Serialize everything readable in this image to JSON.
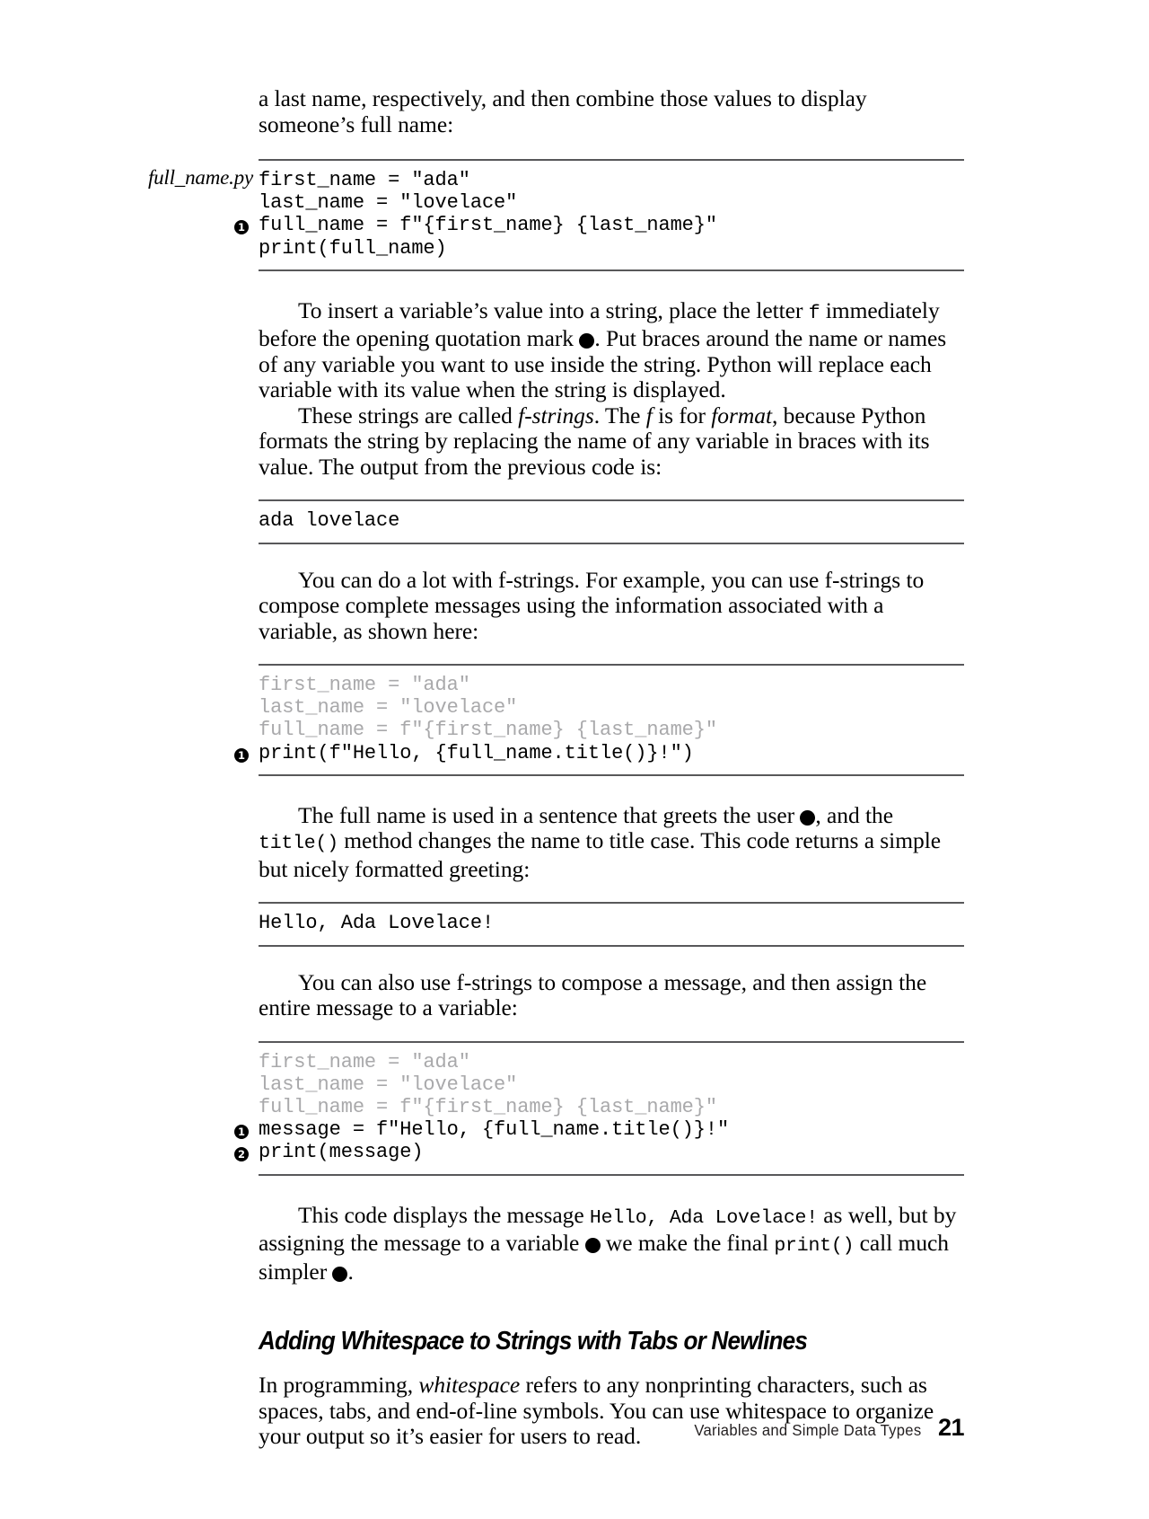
{
  "page": {
    "number": "21",
    "footer_title": "Variables and Simple Data Types"
  },
  "intro_paragraph": {
    "text": "a last name, respectively, and then combine those values to display someone’s full name:"
  },
  "code_block_1": {
    "file_label": "full_name.py",
    "lines": [
      {
        "marker": "",
        "text": "first_name = \"ada\"",
        "dim": false
      },
      {
        "marker": "",
        "text": "last_name = \"lovelace\"",
        "dim": false
      },
      {
        "marker": "❶",
        "text": "full_name = f\"{first_name} {last_name}\"",
        "dim": false
      },
      {
        "marker": "",
        "text": "print(full_name)",
        "dim": false
      }
    ]
  },
  "paragraph_2": {
    "part1": "To insert a variable’s value into a string, place the letter ",
    "code1": "f",
    "part2": " immediately before the opening quotation mark ",
    "marker1": "❶",
    "part3": ". Put braces around the name or names of any variable you want to use inside the string. Python will replace each variable with its value when the string is displayed."
  },
  "paragraph_3": {
    "part1": "These strings are called ",
    "italic1": "f-strings",
    "part2": ". The ",
    "italic2": "f",
    "part3": " is for ",
    "italic3": "format",
    "part4": ", because Python formats the string by replacing the name of any variable in braces with its value. The output from the previous code is:"
  },
  "output_block_1": {
    "lines": [
      {
        "marker": "",
        "text": "ada lovelace",
        "dim": false
      }
    ]
  },
  "paragraph_4": {
    "text": "You can do a lot with f-strings. For example, you can use f-strings to compose complete messages using the information associated with a variable, as shown here:"
  },
  "code_block_2": {
    "lines": [
      {
        "marker": "",
        "text": "first_name = \"ada\"",
        "dim": true
      },
      {
        "marker": "",
        "text": "last_name = \"lovelace\"",
        "dim": true
      },
      {
        "marker": "",
        "text": "full_name = f\"{first_name} {last_name}\"",
        "dim": true
      },
      {
        "marker": "❶",
        "text": "print(f\"Hello, {full_name.title()}!\")",
        "dim": false
      }
    ]
  },
  "paragraph_5": {
    "part1": "The full name is used in a sentence that greets the user ",
    "marker1": "❶",
    "part2": ", and the ",
    "code1": "title()",
    "part3": " method changes the name to title case. This code returns a simple but nicely formatted greeting:"
  },
  "output_block_2": {
    "lines": [
      {
        "marker": "",
        "text": "Hello, Ada Lovelace!",
        "dim": false
      }
    ]
  },
  "paragraph_6": {
    "text": "You can also use f-strings to compose a message, and then assign the entire message to a variable:"
  },
  "code_block_3": {
    "lines": [
      {
        "marker": "",
        "text": "first_name = \"ada\"",
        "dim": true
      },
      {
        "marker": "",
        "text": "last_name = \"lovelace\"",
        "dim": true
      },
      {
        "marker": "",
        "text": "full_name = f\"{first_name} {last_name}\"",
        "dim": true
      },
      {
        "marker": "❶",
        "text": "message = f\"Hello, {full_name.title()}!\"",
        "dim": false
      },
      {
        "marker": "❷",
        "text": "print(message)",
        "dim": false
      }
    ]
  },
  "paragraph_7": {
    "part1": "This code displays the message ",
    "code1": "Hello, Ada Lovelace!",
    "part2": " as well, but by assigning the message to a variable ",
    "marker1": "❶",
    "part3": " we make the final ",
    "code2": "print()",
    "part4": " call much simpler ",
    "marker2": "❷",
    "part5": "."
  },
  "section_heading": {
    "text": "Adding Whitespace to Strings with Tabs or Newlines"
  },
  "paragraph_8": {
    "part1": "In programming, ",
    "italic1": "whitespace",
    "part2": " refers to any nonprinting characters, such as spaces, tabs, and end-of-line symbols. You can use whitespace to organize your output so it’s easier for users to read."
  },
  "colors": {
    "rule": "#58585a",
    "dim_code": "#a9a9ab",
    "text": "#010101",
    "footer_title": "#231f20"
  }
}
